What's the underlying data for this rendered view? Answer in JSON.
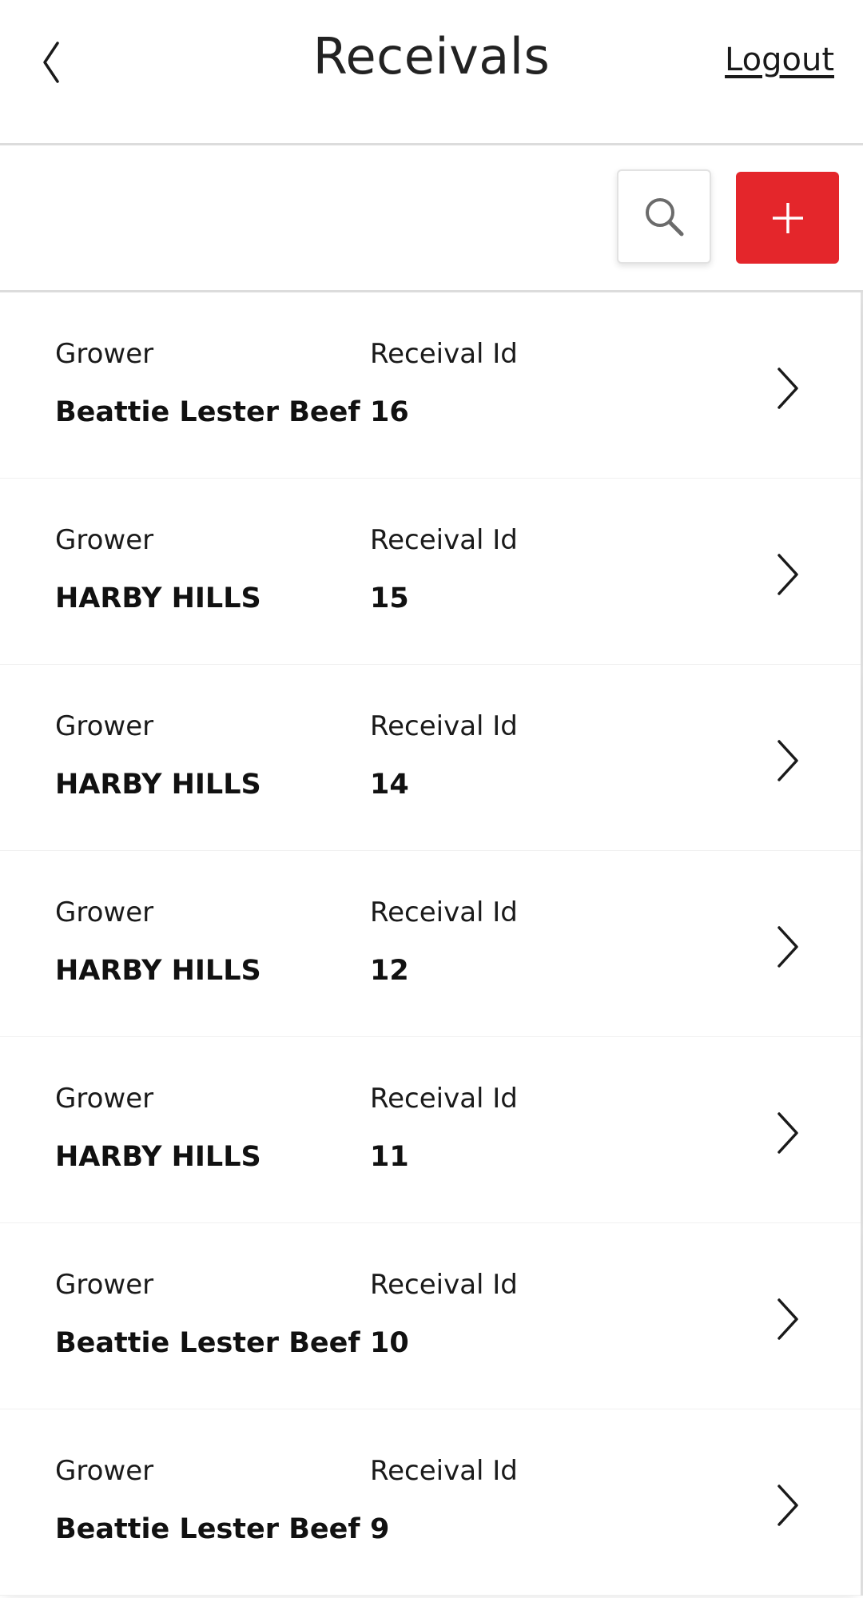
{
  "header": {
    "title": "Receivals",
    "logout_label": "Logout",
    "back_icon": "chevron-left-icon"
  },
  "toolbar": {
    "search_icon": "search-icon",
    "add_icon": "plus-icon",
    "add_color": "#e4262b"
  },
  "list": {
    "grower_label": "Grower",
    "id_label": "Receival Id",
    "items": [
      {
        "grower": "Beattie Lester Beef",
        "receival_id": "16"
      },
      {
        "grower": "HARBY HILLS",
        "receival_id": "15"
      },
      {
        "grower": "HARBY HILLS",
        "receival_id": "14"
      },
      {
        "grower": "HARBY HILLS",
        "receival_id": "12"
      },
      {
        "grower": "HARBY HILLS",
        "receival_id": "11"
      },
      {
        "grower": "Beattie Lester Beef",
        "receival_id": "10"
      },
      {
        "grower": "Beattie Lester Beef",
        "receival_id": "9"
      }
    ]
  }
}
